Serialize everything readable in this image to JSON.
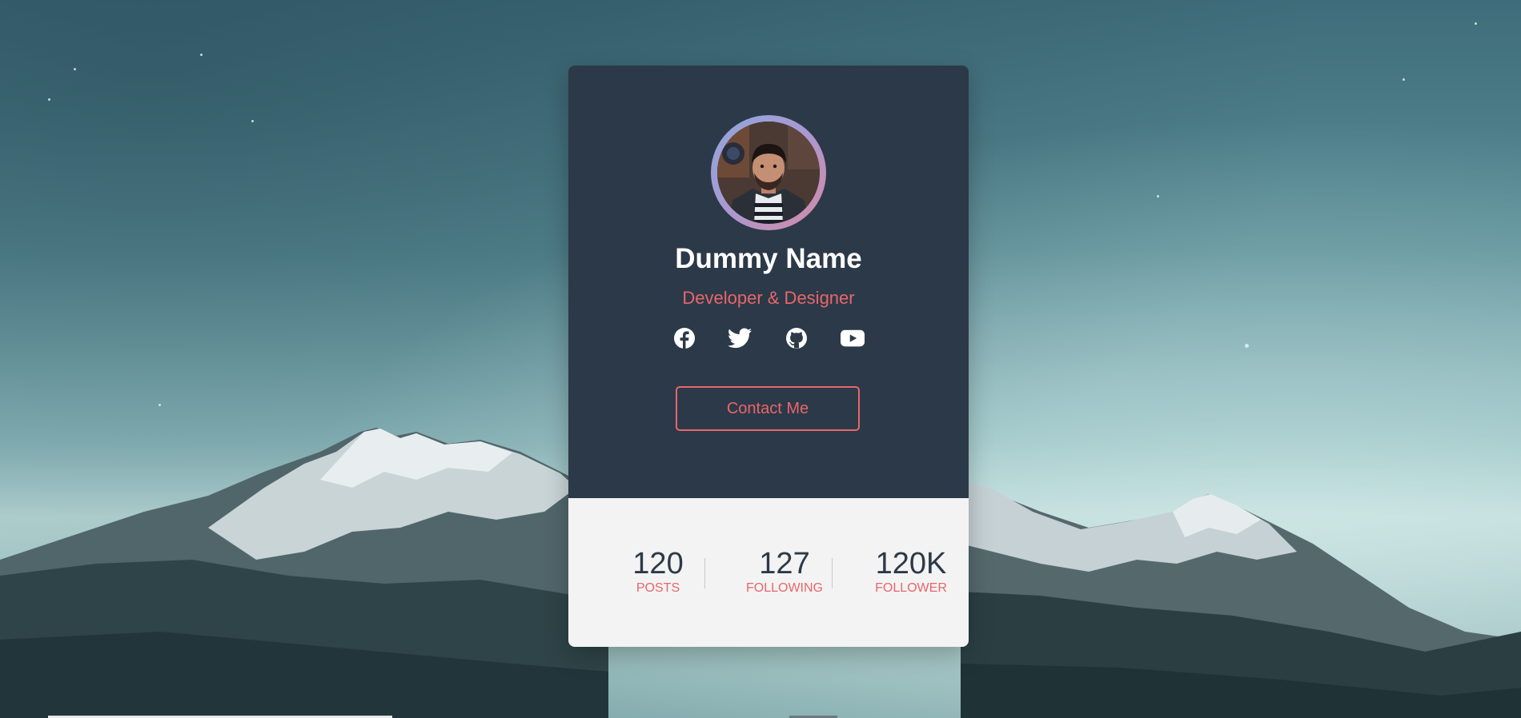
{
  "profile": {
    "name": "Dummy Name",
    "role": "Developer & Designer",
    "contact_label": "Contact Me"
  },
  "socials": [
    {
      "icon": "facebook-icon"
    },
    {
      "icon": "twitter-icon"
    },
    {
      "icon": "github-icon"
    },
    {
      "icon": "youtube-icon"
    }
  ],
  "stats": [
    {
      "value": "120",
      "label": "POSTS"
    },
    {
      "value": "127",
      "label": "FOLLOWING"
    },
    {
      "value": "120K",
      "label": "FOLLOWER"
    }
  ],
  "colors": {
    "card_dark": "#2c3948",
    "accent": "#e8666b",
    "card_light": "#f3f3f3"
  }
}
